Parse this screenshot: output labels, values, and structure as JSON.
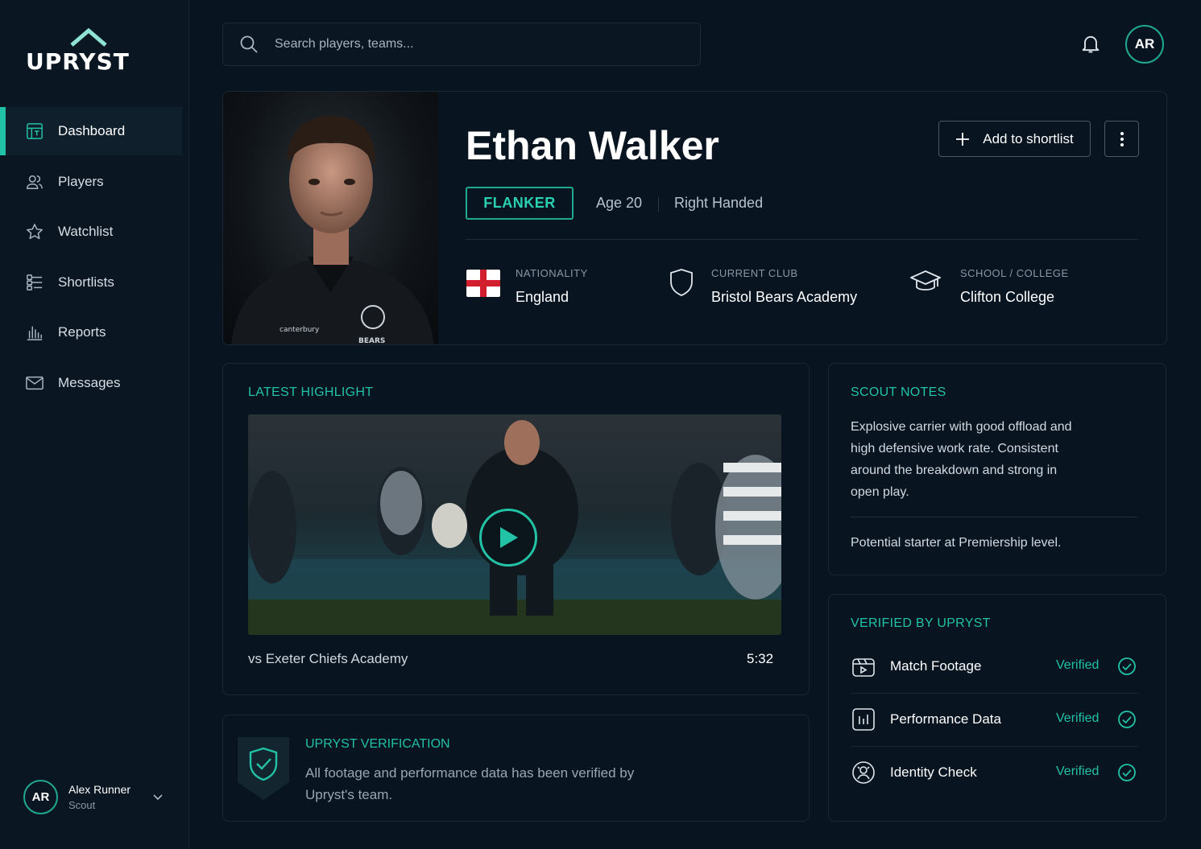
{
  "app": {
    "brand": "UPRYST"
  },
  "sidebar": {
    "items": [
      {
        "label": "Dashboard",
        "icon": "dashboard-icon"
      },
      {
        "label": "Players",
        "icon": "users-icon"
      },
      {
        "label": "Watchlist",
        "icon": "star-icon"
      },
      {
        "label": "Shortlists",
        "icon": "list-icon"
      },
      {
        "label": "Reports",
        "icon": "bar-chart-icon"
      },
      {
        "label": "Messages",
        "icon": "mail-icon"
      }
    ],
    "user": {
      "initials": "AR",
      "name": "Alex Runner",
      "role": "Scout"
    }
  },
  "header": {
    "search_placeholder": "Search players, teams...",
    "avatar_initials": "AR"
  },
  "profile": {
    "name": "Ethan Walker",
    "position": "FLANKER",
    "age": "Age 20",
    "handedness": "Right Handed",
    "shortlist_label": "Add to shortlist",
    "nationality_label": "NATIONALITY",
    "nationality": "England",
    "club_label": "CURRENT CLUB",
    "club": "Bristol Bears Academy",
    "school_label": "SCHOOL / COLLEGE",
    "school": "Clifton College",
    "jersey_sponsor": "canterbury",
    "jersey_badge": "BEARS"
  },
  "highlight": {
    "title": "LATEST HIGHLIGHT",
    "caption": "vs Exeter Chiefs Academy",
    "duration": "5:32"
  },
  "verification": {
    "title": "UPRYST VERIFICATION",
    "text": "All footage and performance data has been verified by Upryst's team."
  },
  "scout_notes": {
    "title": "SCOUT NOTES",
    "paragraph": "Explosive carrier with good offload and high defensive work rate. Consistent around the breakdown and strong in open play.",
    "summary": "Potential starter at Premiership level."
  },
  "verified_by": {
    "title": "VERIFIED BY UPRYST",
    "items": [
      {
        "label": "Match Footage",
        "status": "Verified",
        "icon": "video-icon"
      },
      {
        "label": "Performance Data",
        "status": "Verified",
        "icon": "stats-icon"
      },
      {
        "label": "Identity Check",
        "status": "Verified",
        "icon": "face-id-icon"
      }
    ]
  },
  "colors": {
    "accent": "#22c2a6",
    "background": "#081420",
    "panel": "#0a1622"
  }
}
